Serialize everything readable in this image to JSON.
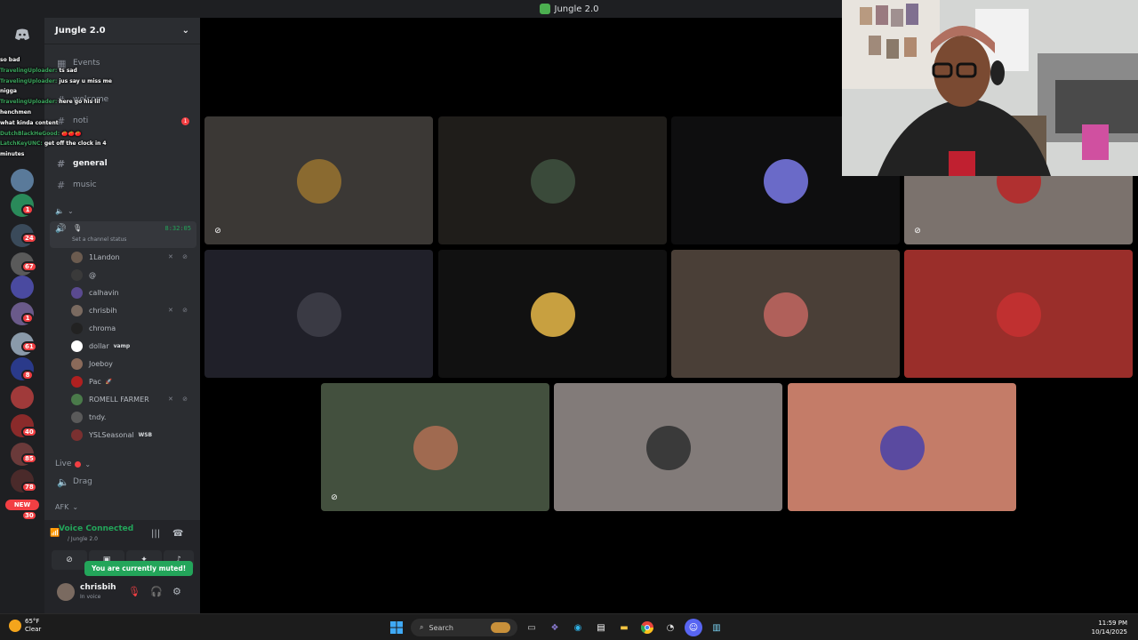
{
  "window": {
    "title": "Jungle 2.0"
  },
  "server_rail": {
    "badges": [
      "1",
      "24",
      "67",
      "1",
      "61",
      "8",
      "40",
      "85",
      "78",
      "30"
    ],
    "new_label": "NEW"
  },
  "guild": {
    "name": "Jungle 2.0"
  },
  "channels": {
    "events": "Events",
    "welcome": "welcome",
    "noti": "noti",
    "noti_badge": "1",
    "general": "general",
    "music": "music"
  },
  "voice_channel": {
    "timer": "8:32:05",
    "status_hint": "Set a channel status",
    "members": [
      {
        "name": "1Landon",
        "tag": "",
        "icons": "✕ ⊘",
        "color": "#6b5b4f"
      },
      {
        "name": "@",
        "tag": "",
        "icons": "",
        "color": "#3a3a3a"
      },
      {
        "name": "calhavin",
        "tag": "",
        "icons": "",
        "color": "#5a4a90"
      },
      {
        "name": "chrisbih",
        "tag": "",
        "icons": "✕ ⊘",
        "color": "#7a6a60"
      },
      {
        "name": "chroma",
        "tag": "",
        "icons": "",
        "color": "#222"
      },
      {
        "name": "dollar",
        "tag": "vamp",
        "icons": "",
        "color": "#fff"
      },
      {
        "name": "Joeboy",
        "tag": "",
        "icons": "",
        "color": "#8a6a5a"
      },
      {
        "name": "Pac",
        "tag": "🚀",
        "icons": "",
        "color": "#b02020"
      },
      {
        "name": "ROMELL FARMER",
        "tag": "",
        "icons": "✕ ⊘",
        "color": "#4a7a4a"
      },
      {
        "name": "tndy.",
        "tag": "",
        "icons": "",
        "color": "#5a5a5a"
      },
      {
        "name": "YSLSeasonal",
        "tag": "WSB",
        "icons": "",
        "color": "#7a3030"
      }
    ]
  },
  "categories": {
    "live": "Live",
    "afk": "AFK"
  },
  "drag_channel": "Drag",
  "chat_overlay": [
    {
      "user": "",
      "text": "so bad"
    },
    {
      "user": "TravelingUploader:",
      "text": "ts sad"
    },
    {
      "user": "TravelingUploader:",
      "text": "jus say u miss me"
    },
    {
      "user": "",
      "text": "nigga"
    },
    {
      "user": "TravelingUploader:",
      "text": "here go his lil"
    },
    {
      "user": "",
      "text": "henchmen"
    },
    {
      "user": "",
      "text": "what kinda content"
    },
    {
      "user": "DutchBlackHeGood:",
      "text": "🍅🍅🍅"
    },
    {
      "user": "LatchKeyUNC:",
      "text": "get off the clock in 4"
    },
    {
      "user": "",
      "text": "minutes"
    }
  ],
  "voice_panel": {
    "status": "Voice Connected",
    "sub": "/ Jungle 2.0",
    "toast": "You are currently muted!"
  },
  "user": {
    "name": "chrisbih",
    "status": "In voice"
  },
  "tiles": [
    {
      "bg": "#3b3835",
      "pic": "#8a6a30",
      "muted": true
    },
    {
      "bg": "#1f1d1a",
      "pic": "#3a4a3a",
      "muted": false
    },
    {
      "bg": "#0e0e0f",
      "pic": "#6a6ac8",
      "muted": false
    },
    {
      "bg": "#7b726d",
      "pic": "#b03030",
      "muted": true
    },
    {
      "bg": "#202029",
      "pic": "#3a3a44",
      "muted": false
    },
    {
      "bg": "#111111",
      "pic": "#c8a040",
      "muted": false
    },
    {
      "bg": "#4a3f37",
      "pic": "#b0605a",
      "muted": false
    },
    {
      "bg": "#9a2e2a",
      "pic": "#c03030",
      "muted": false
    },
    {
      "bg": "#43503e",
      "pic": "#a06a50",
      "muted": true
    },
    {
      "bg": "#827b79",
      "pic": "#3a3a3a",
      "muted": false
    },
    {
      "bg": "#c47c68",
      "pic": "#5a4aa0",
      "muted": false
    }
  ],
  "taskbar": {
    "temp": "65°F",
    "condition": "Clear",
    "search": "Search",
    "time": "11:59 PM",
    "date": "10/14/2025"
  }
}
